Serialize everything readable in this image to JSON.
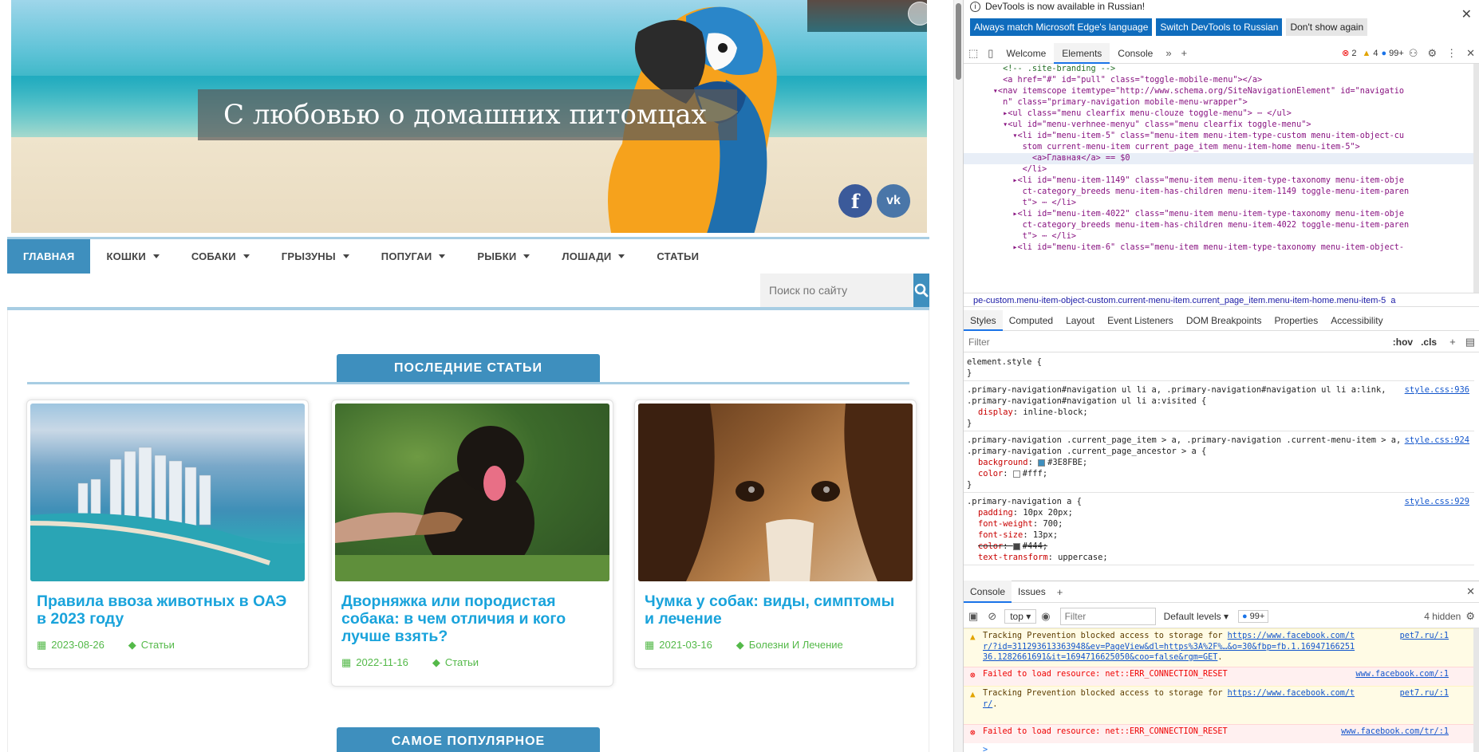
{
  "site": {
    "hero_title": "С любовью о домашних питомцах",
    "social": {
      "facebook": "f",
      "vk": "vk"
    },
    "nav": [
      {
        "label": "Главная",
        "active": true,
        "dropdown": false
      },
      {
        "label": "Кошки",
        "active": false,
        "dropdown": true
      },
      {
        "label": "Собаки",
        "active": false,
        "dropdown": true
      },
      {
        "label": "Грызуны",
        "active": false,
        "dropdown": true
      },
      {
        "label": "Попугаи",
        "active": false,
        "dropdown": true
      },
      {
        "label": "Рыбки",
        "active": false,
        "dropdown": true
      },
      {
        "label": "Лошади",
        "active": false,
        "dropdown": true
      },
      {
        "label": "Статьи",
        "active": false,
        "dropdown": false
      }
    ],
    "search_placeholder": "Поиск по сайту",
    "section_latest": "Последние статьи",
    "section_popular": "Самое популярное",
    "articles": [
      {
        "title": "Правила ввоза животных в ОАЭ в 2023 году",
        "date": "2023-08-26",
        "category": "Статьи"
      },
      {
        "title": "Дворняжка или породистая собака: в чем отличия и кого лучше взять?",
        "date": "2022-11-16",
        "category": "Статьи"
      },
      {
        "title": "Чумка у собак: виды, симптомы и лечение",
        "date": "2021-03-16",
        "category": "Болезни И Лечение"
      }
    ],
    "colors": {
      "accent": "#3E8FBE",
      "link": "#19A3DB",
      "meta": "#54B949",
      "nav_line": "#A7CDE3"
    }
  },
  "devtools": {
    "info_text": "DevTools is now available in Russian!",
    "lang_buttons": [
      "Always match Microsoft Edge's language",
      "Switch DevTools to Russian",
      "Don't show again"
    ],
    "tabs": [
      "Welcome",
      "Elements",
      "Console"
    ],
    "selected_tab": "Elements",
    "errors": "2",
    "warnings": "4",
    "messages": "99+",
    "elements_lines": [
      "        <!-- .site-branding -->",
      "        <a href=\"#\" id=\"pull\" class=\"toggle-mobile-menu\"></a>",
      "      ▾<nav itemscope itemtype=\"http://www.schema.org/SiteNavigationElement\" id=\"navigatio",
      "        n\" class=\"primary-navigation mobile-menu-wrapper\">",
      "        ▸<ul class=\"menu clearfix menu-clouze toggle-menu\"> ⋯ </ul>",
      "        ▾<ul id=\"menu-verhnee-menyu\" class=\"menu clearfix toggle-menu\">",
      "          ▾<li id=\"menu-item-5\" class=\"menu-item menu-item-type-custom menu-item-object-cu",
      "            stom current-menu-item current_page_item menu-item-home menu-item-5\">",
      "              <a>Главная</a> == $0",
      "            </li>",
      "          ▸<li id=\"menu-item-1149\" class=\"menu-item menu-item-type-taxonomy menu-item-obje",
      "            ct-category_breeds menu-item-has-children menu-item-1149 toggle-menu-item-paren",
      "            t\"> ⋯ </li>",
      "          ▸<li id=\"menu-item-4022\" class=\"menu-item menu-item-type-taxonomy menu-item-obje",
      "            ct-category_breeds menu-item-has-children menu-item-4022 toggle-menu-item-paren",
      "            t\"> ⋯ </li>",
      "          ▸<li id=\"menu-item-6\" class=\"menu-item menu-item-type-taxonomy menu-item-object-"
    ],
    "breadcrumb": "pe-custom.menu-item-object-custom.current-menu-item.current_page_item.menu-item-home.menu-item-5",
    "breadcrumb_tail": "a",
    "styles_tabs": [
      "Styles",
      "Computed",
      "Layout",
      "Event Listeners",
      "DOM Breakpoints",
      "Properties",
      "Accessibility"
    ],
    "filter_placeholder": "Filter",
    "hov": ":hov",
    "cls": ".cls",
    "rules": [
      {
        "selector": "element.style {",
        "source": "",
        "props": [],
        "close": "}"
      },
      {
        "selector": ".primary-navigation#navigation ul li a, .primary-navigation#navigation ul li a:link, .primary-navigation#navigation ul li a:visited {",
        "source": "style.css:936",
        "props": [
          {
            "name": "display",
            "value": "inline-block;"
          }
        ],
        "close": "}"
      },
      {
        "selector": ".primary-navigation .current_page_item > a, .primary-navigation .current-menu-item > a, .primary-navigation .current_page_ancestor > a {",
        "source": "style.css:924",
        "props": [
          {
            "name": "background",
            "value": "#3E8FBE;"
          },
          {
            "name": "color",
            "value": "#fff;"
          }
        ],
        "close": "}"
      },
      {
        "selector": ".primary-navigation a {",
        "source": "style.css:929",
        "props": [
          {
            "name": "padding",
            "value": "10px 20px;"
          },
          {
            "name": "font-weight",
            "value": "700;"
          },
          {
            "name": "font-size",
            "value": "13px;"
          },
          {
            "name": "color",
            "value": "#444;"
          },
          {
            "name": "text-transform",
            "value": "uppercase;"
          }
        ],
        "close": ""
      }
    ],
    "console_tabs": [
      "Console",
      "Issues"
    ],
    "context": "top",
    "console_filter": "Filter",
    "levels": "Default levels",
    "msg_count": "99+",
    "hidden": "4 hidden",
    "messages_list": [
      {
        "type": "warn",
        "text": "Tracking Prevention blocked access to storage for ",
        "link": "https://www.facebook.com/tr/?id=311293613363948&ev=PageView&dl=https%3A%2F%…&o=30&fbp=fb.1.1694716625136.1282661691&it=1694716625050&coo=false&rgm=GET",
        "end": ".",
        "source": "pet7.ru/:1"
      },
      {
        "type": "err",
        "text": "Failed to load resource: net::ERR_CONNECTION_RESET",
        "link": "",
        "end": "",
        "source": "www.facebook.com/:1"
      },
      {
        "type": "warn",
        "text": "Tracking Prevention blocked access to storage for ",
        "link": "https://www.facebook.com/tr/",
        "end": ".",
        "source": "pet7.ru/:1"
      },
      {
        "type": "err",
        "text": "Failed to load resource: net::ERR_CONNECTION_RESET",
        "link": "",
        "end": "",
        "source": "www.facebook.com/tr/:1"
      }
    ],
    "prompt": ">"
  }
}
